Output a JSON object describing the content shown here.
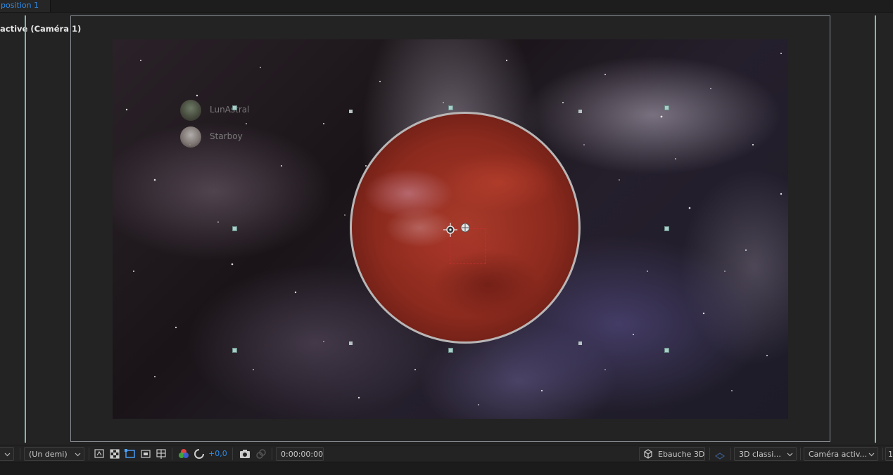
{
  "tab": {
    "label": "position 1"
  },
  "viewer": {
    "camera_label": "active (Caméra 1)"
  },
  "layers": [
    {
      "name": "LunAstral"
    },
    {
      "name": "Starboy"
    }
  ],
  "toolbar": {
    "resolution": "(Un demi)",
    "exposure": "+0,0",
    "timecode": "0:00:00:00",
    "renderer": "Ebauche 3D",
    "view_mode": "3D  classi...",
    "camera_view": "Caméra activ...",
    "edge_value": "1"
  },
  "colors": {
    "accent_blue": "#2d8ceb",
    "guide": "#7fb7b2",
    "handle": "#a9cfca",
    "planet_red": "#a83a2a"
  }
}
